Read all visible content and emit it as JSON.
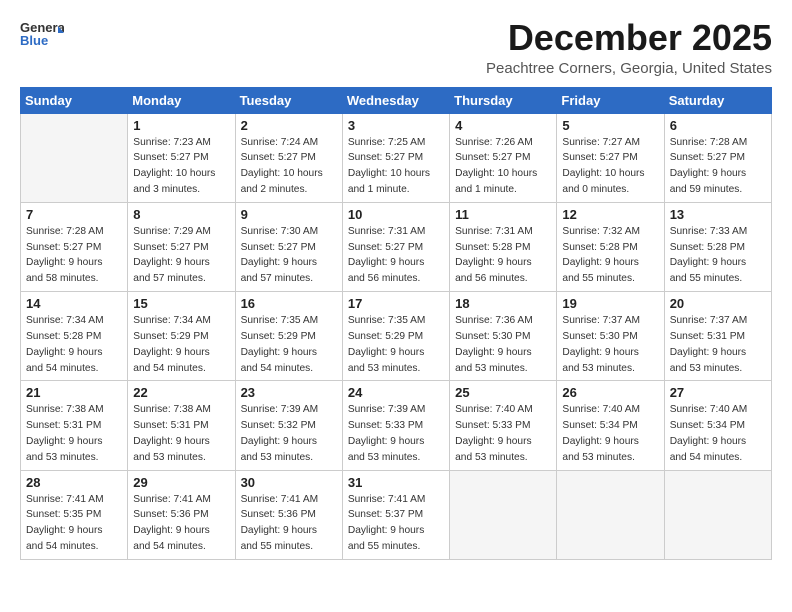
{
  "header": {
    "logo_line1": "General",
    "logo_line2": "Blue",
    "month": "December 2025",
    "location": "Peachtree Corners, Georgia, United States"
  },
  "days_of_week": [
    "Sunday",
    "Monday",
    "Tuesday",
    "Wednesday",
    "Thursday",
    "Friday",
    "Saturday"
  ],
  "weeks": [
    [
      {
        "day": "",
        "info": ""
      },
      {
        "day": "1",
        "info": "Sunrise: 7:23 AM\nSunset: 5:27 PM\nDaylight: 10 hours\nand 3 minutes."
      },
      {
        "day": "2",
        "info": "Sunrise: 7:24 AM\nSunset: 5:27 PM\nDaylight: 10 hours\nand 2 minutes."
      },
      {
        "day": "3",
        "info": "Sunrise: 7:25 AM\nSunset: 5:27 PM\nDaylight: 10 hours\nand 1 minute."
      },
      {
        "day": "4",
        "info": "Sunrise: 7:26 AM\nSunset: 5:27 PM\nDaylight: 10 hours\nand 1 minute."
      },
      {
        "day": "5",
        "info": "Sunrise: 7:27 AM\nSunset: 5:27 PM\nDaylight: 10 hours\nand 0 minutes."
      },
      {
        "day": "6",
        "info": "Sunrise: 7:28 AM\nSunset: 5:27 PM\nDaylight: 9 hours\nand 59 minutes."
      }
    ],
    [
      {
        "day": "7",
        "info": "Sunrise: 7:28 AM\nSunset: 5:27 PM\nDaylight: 9 hours\nand 58 minutes."
      },
      {
        "day": "8",
        "info": "Sunrise: 7:29 AM\nSunset: 5:27 PM\nDaylight: 9 hours\nand 57 minutes."
      },
      {
        "day": "9",
        "info": "Sunrise: 7:30 AM\nSunset: 5:27 PM\nDaylight: 9 hours\nand 57 minutes."
      },
      {
        "day": "10",
        "info": "Sunrise: 7:31 AM\nSunset: 5:27 PM\nDaylight: 9 hours\nand 56 minutes."
      },
      {
        "day": "11",
        "info": "Sunrise: 7:31 AM\nSunset: 5:28 PM\nDaylight: 9 hours\nand 56 minutes."
      },
      {
        "day": "12",
        "info": "Sunrise: 7:32 AM\nSunset: 5:28 PM\nDaylight: 9 hours\nand 55 minutes."
      },
      {
        "day": "13",
        "info": "Sunrise: 7:33 AM\nSunset: 5:28 PM\nDaylight: 9 hours\nand 55 minutes."
      }
    ],
    [
      {
        "day": "14",
        "info": "Sunrise: 7:34 AM\nSunset: 5:28 PM\nDaylight: 9 hours\nand 54 minutes."
      },
      {
        "day": "15",
        "info": "Sunrise: 7:34 AM\nSunset: 5:29 PM\nDaylight: 9 hours\nand 54 minutes."
      },
      {
        "day": "16",
        "info": "Sunrise: 7:35 AM\nSunset: 5:29 PM\nDaylight: 9 hours\nand 54 minutes."
      },
      {
        "day": "17",
        "info": "Sunrise: 7:35 AM\nSunset: 5:29 PM\nDaylight: 9 hours\nand 53 minutes."
      },
      {
        "day": "18",
        "info": "Sunrise: 7:36 AM\nSunset: 5:30 PM\nDaylight: 9 hours\nand 53 minutes."
      },
      {
        "day": "19",
        "info": "Sunrise: 7:37 AM\nSunset: 5:30 PM\nDaylight: 9 hours\nand 53 minutes."
      },
      {
        "day": "20",
        "info": "Sunrise: 7:37 AM\nSunset: 5:31 PM\nDaylight: 9 hours\nand 53 minutes."
      }
    ],
    [
      {
        "day": "21",
        "info": "Sunrise: 7:38 AM\nSunset: 5:31 PM\nDaylight: 9 hours\nand 53 minutes."
      },
      {
        "day": "22",
        "info": "Sunrise: 7:38 AM\nSunset: 5:31 PM\nDaylight: 9 hours\nand 53 minutes."
      },
      {
        "day": "23",
        "info": "Sunrise: 7:39 AM\nSunset: 5:32 PM\nDaylight: 9 hours\nand 53 minutes."
      },
      {
        "day": "24",
        "info": "Sunrise: 7:39 AM\nSunset: 5:33 PM\nDaylight: 9 hours\nand 53 minutes."
      },
      {
        "day": "25",
        "info": "Sunrise: 7:40 AM\nSunset: 5:33 PM\nDaylight: 9 hours\nand 53 minutes."
      },
      {
        "day": "26",
        "info": "Sunrise: 7:40 AM\nSunset: 5:34 PM\nDaylight: 9 hours\nand 53 minutes."
      },
      {
        "day": "27",
        "info": "Sunrise: 7:40 AM\nSunset: 5:34 PM\nDaylight: 9 hours\nand 54 minutes."
      }
    ],
    [
      {
        "day": "28",
        "info": "Sunrise: 7:41 AM\nSunset: 5:35 PM\nDaylight: 9 hours\nand 54 minutes."
      },
      {
        "day": "29",
        "info": "Sunrise: 7:41 AM\nSunset: 5:36 PM\nDaylight: 9 hours\nand 54 minutes."
      },
      {
        "day": "30",
        "info": "Sunrise: 7:41 AM\nSunset: 5:36 PM\nDaylight: 9 hours\nand 55 minutes."
      },
      {
        "day": "31",
        "info": "Sunrise: 7:41 AM\nSunset: 5:37 PM\nDaylight: 9 hours\nand 55 minutes."
      },
      {
        "day": "",
        "info": ""
      },
      {
        "day": "",
        "info": ""
      },
      {
        "day": "",
        "info": ""
      }
    ]
  ]
}
